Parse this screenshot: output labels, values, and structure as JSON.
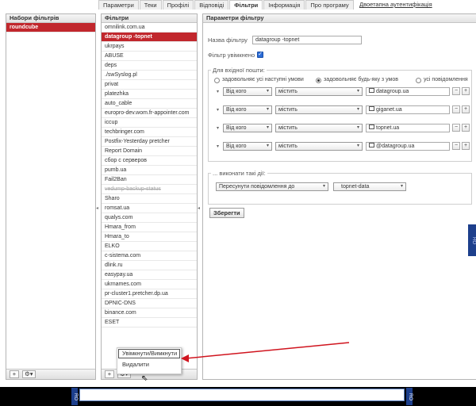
{
  "tabs": [
    "Параметри",
    "Теки",
    "Профілі",
    "Відповіді",
    "Фільтри",
    "Інформація",
    "Про програму"
  ],
  "active_tab": "Фільтри",
  "tab_extra_link": "Двоетапна аутентифікація",
  "sets_panel": {
    "title": "Набори фільтрів",
    "items": [
      "roundcube"
    ],
    "selected": "roundcube",
    "add": "+",
    "menu": "⚙▾"
  },
  "filters_panel": {
    "title": "Фільтри",
    "items": [
      "omnilink.com.ua",
      "datagroup -topnet",
      "ukrpays",
      "ABUSE",
      "deps",
      "./swSyslog.pl",
      "privat",
      "platezhka",
      "auto_cable",
      "europro-dev.wom.fr-appointer.com",
      "iccup",
      "techbringer.com",
      "Postfix-Yesterday pretcher",
      "Report Domain",
      "сбор с серверов",
      "pumb.ua",
      "Fail2Ban",
      "vedump-backup-status",
      "Sharo",
      "romsat.ua",
      "qualys.com",
      "Hmara_from",
      "Hmara_to",
      "ELKO",
      "c-sistema.com",
      "dlink.ru",
      "easypay.ua",
      "ukrnames.com",
      "pr-cluster1.pretcher.dp.ua",
      "DPNIC-DNS",
      "binance.com",
      "ESET"
    ],
    "selected": "datagroup -topnet",
    "disabled": [
      "vedump-backup-status"
    ],
    "add": "+",
    "menu": "⚙▾"
  },
  "params": {
    "title": "Параметри фільтру",
    "name_label": "Назва фільтру",
    "name_value": "datagroup -topnet",
    "enabled_label": "Фільтр увімкнено",
    "incoming_legend": "Для вхідної пошти:",
    "radio_all": "задовольняє усі наступні умови",
    "radio_any": "задовольняє будь-яку з умов",
    "radio_every": "усі повідомлення",
    "rules": [
      {
        "header": "Від кого",
        "op": "містить",
        "value": "datagroup.ua"
      },
      {
        "header": "Від кого",
        "op": "містить",
        "value": "giganet.ua"
      },
      {
        "header": "Від кого",
        "op": "містить",
        "value": "topnet.ua"
      },
      {
        "header": "Від кого",
        "op": "містить",
        "value": "@datagroup.ua"
      }
    ],
    "actions_legend": "... виконати такі дії:",
    "action": "Пересунути повідомлення до",
    "folder": "topnet-data",
    "save": "Зберегти"
  },
  "context_menu": {
    "toggle": "Увімкнути/Вимкнути",
    "delete": "Видалити"
  },
  "side_tag": "RO",
  "taskbar_tag": "RO"
}
